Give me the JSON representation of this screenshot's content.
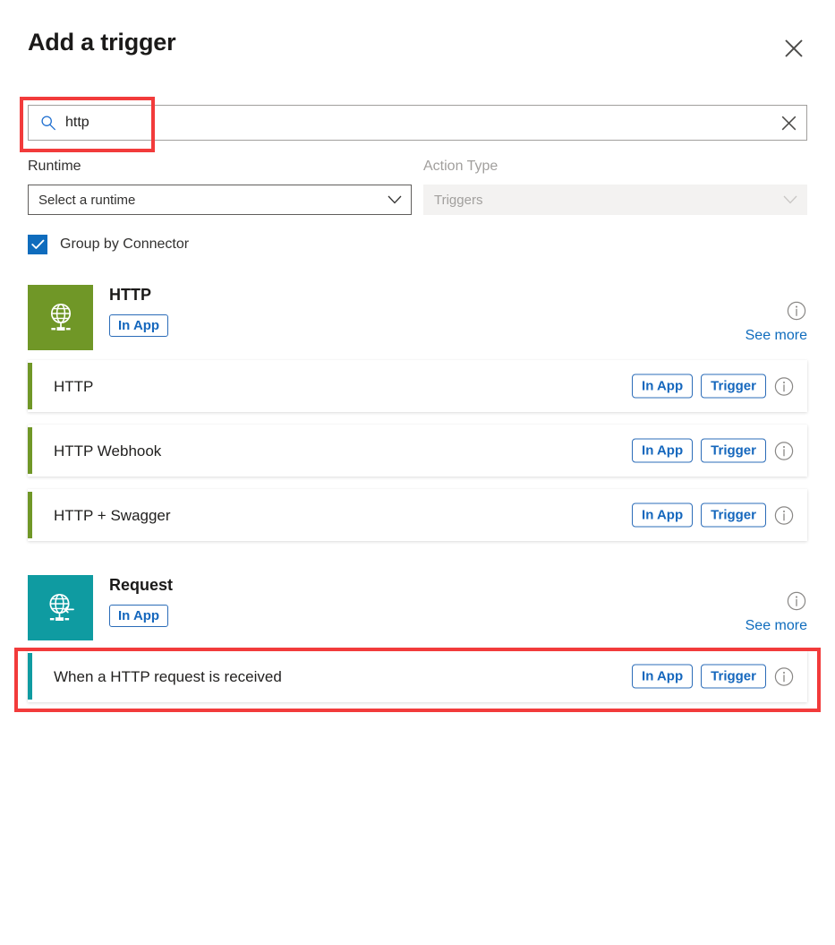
{
  "panel": {
    "title": "Add a trigger",
    "close_label": "Close"
  },
  "search": {
    "value": "http",
    "placeholder": "Search",
    "icon": "search-icon",
    "clear_icon": "clear-icon"
  },
  "filters": {
    "runtime": {
      "label": "Runtime",
      "value": "Select a runtime",
      "disabled": false
    },
    "action_type": {
      "label": "Action Type",
      "value": "Triggers",
      "disabled": true
    }
  },
  "group_by_connector": {
    "label": "Group by Connector",
    "checked": true
  },
  "colors": {
    "accent_blue": "#0f6cbd",
    "http_green": "#709727",
    "request_teal": "#0f9ba1",
    "annotation_red": "#f23b3b"
  },
  "labels": {
    "in_app": "In App",
    "trigger": "Trigger",
    "see_more": "See more",
    "info_icon": "info-icon"
  },
  "connectors": [
    {
      "name": "HTTP",
      "badge": "In App",
      "see_more": "See more",
      "tile_color": "#709727",
      "tile_icon": "globe-network-icon",
      "operations": [
        {
          "name": "HTTP",
          "badge": "In App",
          "kind": "Trigger",
          "accent": "#709727"
        },
        {
          "name": "HTTP Webhook",
          "badge": "In App",
          "kind": "Trigger",
          "accent": "#709727"
        },
        {
          "name": "HTTP + Swagger",
          "badge": "In App",
          "kind": "Trigger",
          "accent": "#709727"
        }
      ]
    },
    {
      "name": "Request",
      "badge": "In App",
      "see_more": "See more",
      "tile_color": "#0f9ba1",
      "tile_icon": "globe-incoming-arrow-icon",
      "operations": [
        {
          "name": "When a HTTP request is received",
          "badge": "In App",
          "kind": "Trigger",
          "accent": "#0f9ba1"
        }
      ]
    }
  ]
}
